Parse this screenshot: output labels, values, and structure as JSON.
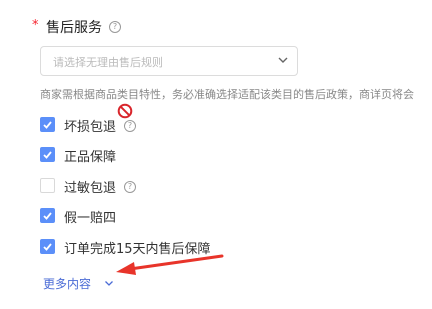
{
  "section": {
    "required_mark": "*",
    "title": "售后服务",
    "help_icon": "question-circle-icon"
  },
  "select": {
    "placeholder": "请选择无理由售后规则",
    "chevron_icon": "chevron-down-icon"
  },
  "description": "商家需根据商品类目特性，务必准确选择适配该类目的售后政策，商详页将会",
  "options": [
    {
      "label": "坏损包退",
      "checked": true,
      "has_help": true
    },
    {
      "label": "正品保障",
      "checked": true,
      "has_help": false
    },
    {
      "label": "过敏包退",
      "checked": false,
      "has_help": true
    },
    {
      "label": "假一赔四",
      "checked": true,
      "has_help": false
    },
    {
      "label": "订单完成15天内售后保障",
      "checked": true,
      "has_help": false
    }
  ],
  "more": {
    "label": "更多内容",
    "chevron_icon": "chevron-down-icon"
  },
  "annotations": {
    "no_sign_icon": "no-entry-icon",
    "arrow_icon": "red-arrow-icon",
    "arrow_color": "#e8342a",
    "accent_color": "#5b8ff9"
  }
}
